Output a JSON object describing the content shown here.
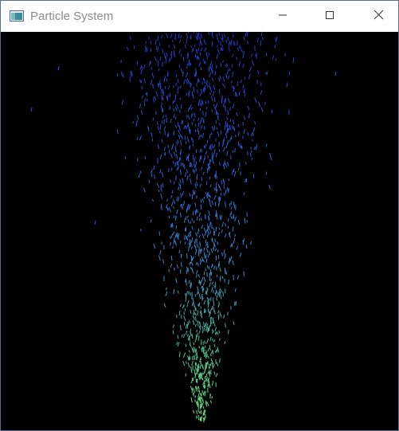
{
  "window": {
    "title": "Particle System",
    "app_icon": "application-icon",
    "controls": {
      "minimize_icon": "minimize-icon",
      "maximize_icon": "maximize-icon",
      "close_icon": "close-icon"
    }
  },
  "scene": {
    "background": "#000000",
    "emitter_color": "#66dd77",
    "top_color": "#2233cc",
    "mid_color": "#3a7fc8"
  }
}
